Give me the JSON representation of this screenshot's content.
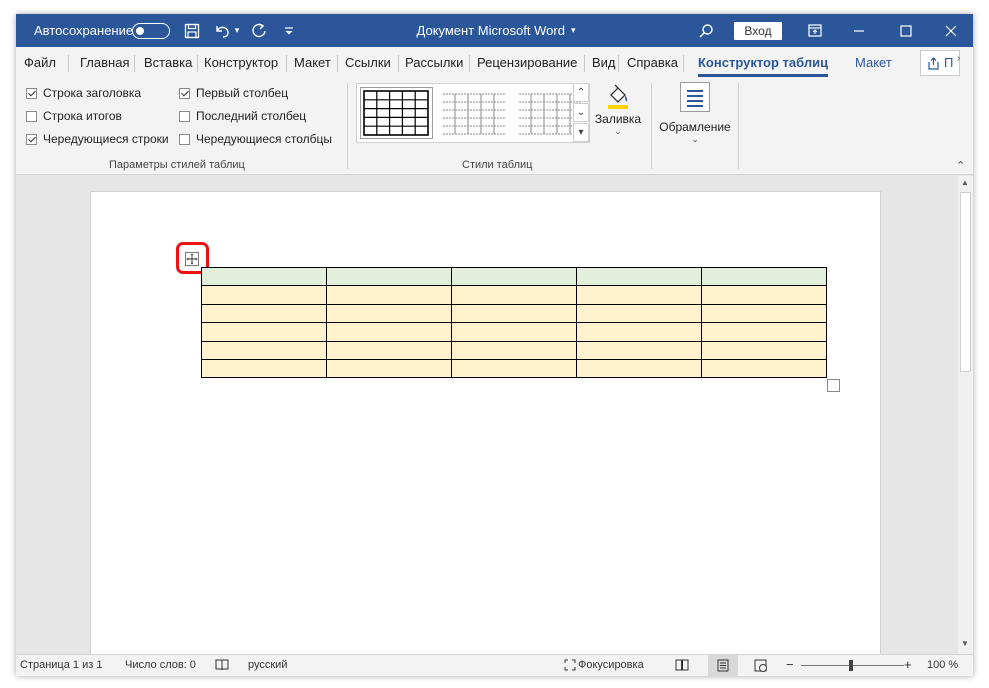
{
  "titlebar": {
    "autosave_label": "Автосохранение",
    "doc_title": "Документ Microsoft Word",
    "signin_label": "Вход"
  },
  "tabs": [
    "Файл",
    "Главная",
    "Вставка",
    "Конструктор",
    "Макет",
    "Ссылки",
    "Рассылки",
    "Рецензирование",
    "Вид",
    "Справка"
  ],
  "tab_active": "Конструктор таблиц",
  "tab_layout": "Макет",
  "share_label": "П",
  "ribbon": {
    "style_options": {
      "header_row": "Строка заголовка",
      "total_row": "Строка итогов",
      "banded_rows": "Чередующиеся строки",
      "first_column": "Первый столбец",
      "last_column": "Последний столбец",
      "banded_columns": "Чередующиеся столбцы",
      "group_label": "Параметры стилей таблиц"
    },
    "table_styles": {
      "group_label": "Стили таблиц"
    },
    "shading_label": "Заливка",
    "borders_label": "Обрамление"
  },
  "checkbox_state": {
    "header_row": true,
    "total_row": false,
    "banded_rows": true,
    "first_column": true,
    "last_column": false,
    "banded_columns": false
  },
  "table": {
    "rows": 6,
    "columns": 5,
    "header_fill": "#e2efda",
    "body_fill": "#fff2cc"
  },
  "statusbar": {
    "page": "Страница 1 из 1",
    "words": "Число слов: 0",
    "language": "русский",
    "focus": "Фокусировка",
    "zoom": "100 %"
  },
  "colors": {
    "accent": "#2b579a",
    "highlight": "#e11111"
  }
}
